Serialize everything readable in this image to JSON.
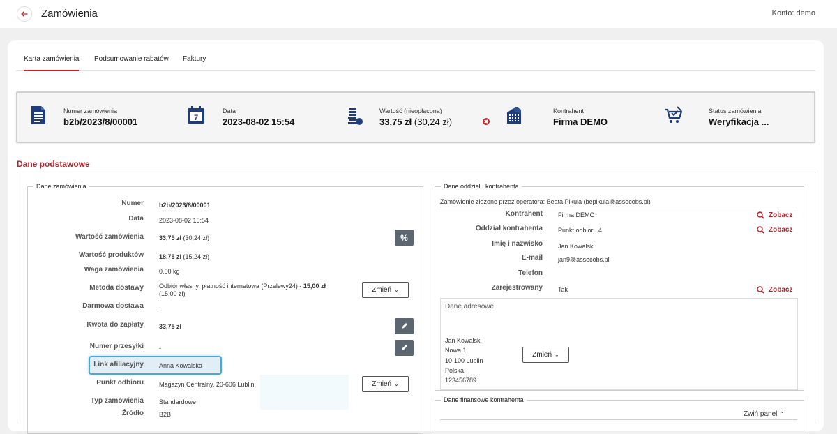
{
  "header": {
    "title": "Zamówienia",
    "account": "Konto: demo"
  },
  "tabs": [
    {
      "label": "Karta zamówienia",
      "active": true
    },
    {
      "label": "Podsumowanie rabatów",
      "active": false
    },
    {
      "label": "Faktury",
      "active": false
    }
  ],
  "summary": {
    "order_number": {
      "label": "Numer zamówienia",
      "value": "b2b/2023/8/00001",
      "icon": "document-icon"
    },
    "date": {
      "label": "Data",
      "value": "2023-08-02 15:54",
      "icon": "calendar-icon"
    },
    "value": {
      "label": "Wartość (nieopłacona)",
      "value_main": "33,75 zł",
      "value_secondary": "(30,24 zł)",
      "icon": "coins-icon"
    },
    "contractor": {
      "label": "Kontrahent",
      "value": "Firma DEMO",
      "icon": "building-icon"
    },
    "status": {
      "label": "Status zamówienia",
      "value": "Weryfikacja ...",
      "icon": "cart-check-icon"
    }
  },
  "section_title": "Dane podstawowe",
  "order_data": {
    "legend": "Dane zamówienia",
    "rows": {
      "number": {
        "label": "Numer",
        "value": "b2b/2023/8/00001"
      },
      "date": {
        "label": "Data",
        "value": "2023-08-02 15:54"
      },
      "order_value": {
        "label": "Wartość zamówienia",
        "value_bold": "33,75 zł",
        "value_rest": "(30,24 zł)"
      },
      "products_value": {
        "label": "Wartość produktów",
        "value_bold": "18,75 zł",
        "value_rest": "(15,24 zł)"
      },
      "weight": {
        "label": "Waga zamówienia",
        "value": "0.00 kg"
      },
      "delivery": {
        "label": "Metoda dostawy",
        "value_line1": "Odbiór własny, płatność internetowa (Przelewy24) - ",
        "value_bold": "15,00 zł",
        "value_line2": "(15,00 zł)"
      },
      "free_delivery": {
        "label": "Darmowa dostawa",
        "value": "-"
      },
      "amount_due": {
        "label": "Kwota do zapłaty",
        "value": "33,75 zł"
      },
      "tracking": {
        "label": "Numer przesyłki",
        "value": "-"
      },
      "affiliate": {
        "label": "Link afiliacyjny",
        "value": "Anna Kowalska"
      },
      "pickup": {
        "label": "Punkt odbioru",
        "value": "Magazyn Centralny, 20-606 Lublin"
      },
      "type": {
        "label": "Typ zamówienia",
        "value": "Standardowe"
      },
      "source": {
        "label": "Źródło",
        "value": "B2B"
      }
    },
    "change_label": "Zmień",
    "discount_btn": "%"
  },
  "branch": {
    "legend": "Dane oddziału kontrahenta",
    "note": "Zamówienie złożone przez operatora: Beata Pikuła (bepikula@assecobs.pl)",
    "rows": {
      "contractor": {
        "label": "Kontrahent",
        "value": "Firma DEMO"
      },
      "branch": {
        "label": "Oddział kontrahenta",
        "value": "Punkt odbioru 4"
      },
      "name": {
        "label": "Imię i nazwisko",
        "value": "Jan Kowalski"
      },
      "email": {
        "label": "E-mail",
        "value": "jan9@assecobs.pl"
      },
      "phone": {
        "label": "Telefon",
        "value": ""
      },
      "registered": {
        "label": "Zarejestrowany",
        "value": "Tak"
      }
    },
    "see_label": "Zobacz",
    "address_title": "Dane adresowe",
    "address": [
      "Jan Kowalski",
      "Nowa 1",
      "10-100 Lublin",
      "Polska",
      "123456789"
    ],
    "change_label": "Zmień"
  },
  "finance": {
    "legend": "Dane finansowe kontrahenta",
    "collapse_label": "Zwiń panel"
  },
  "colors": {
    "accent": "#c0272d",
    "icon_blue": "#1f3d7a",
    "highlight_border": "#4aa7d6"
  }
}
